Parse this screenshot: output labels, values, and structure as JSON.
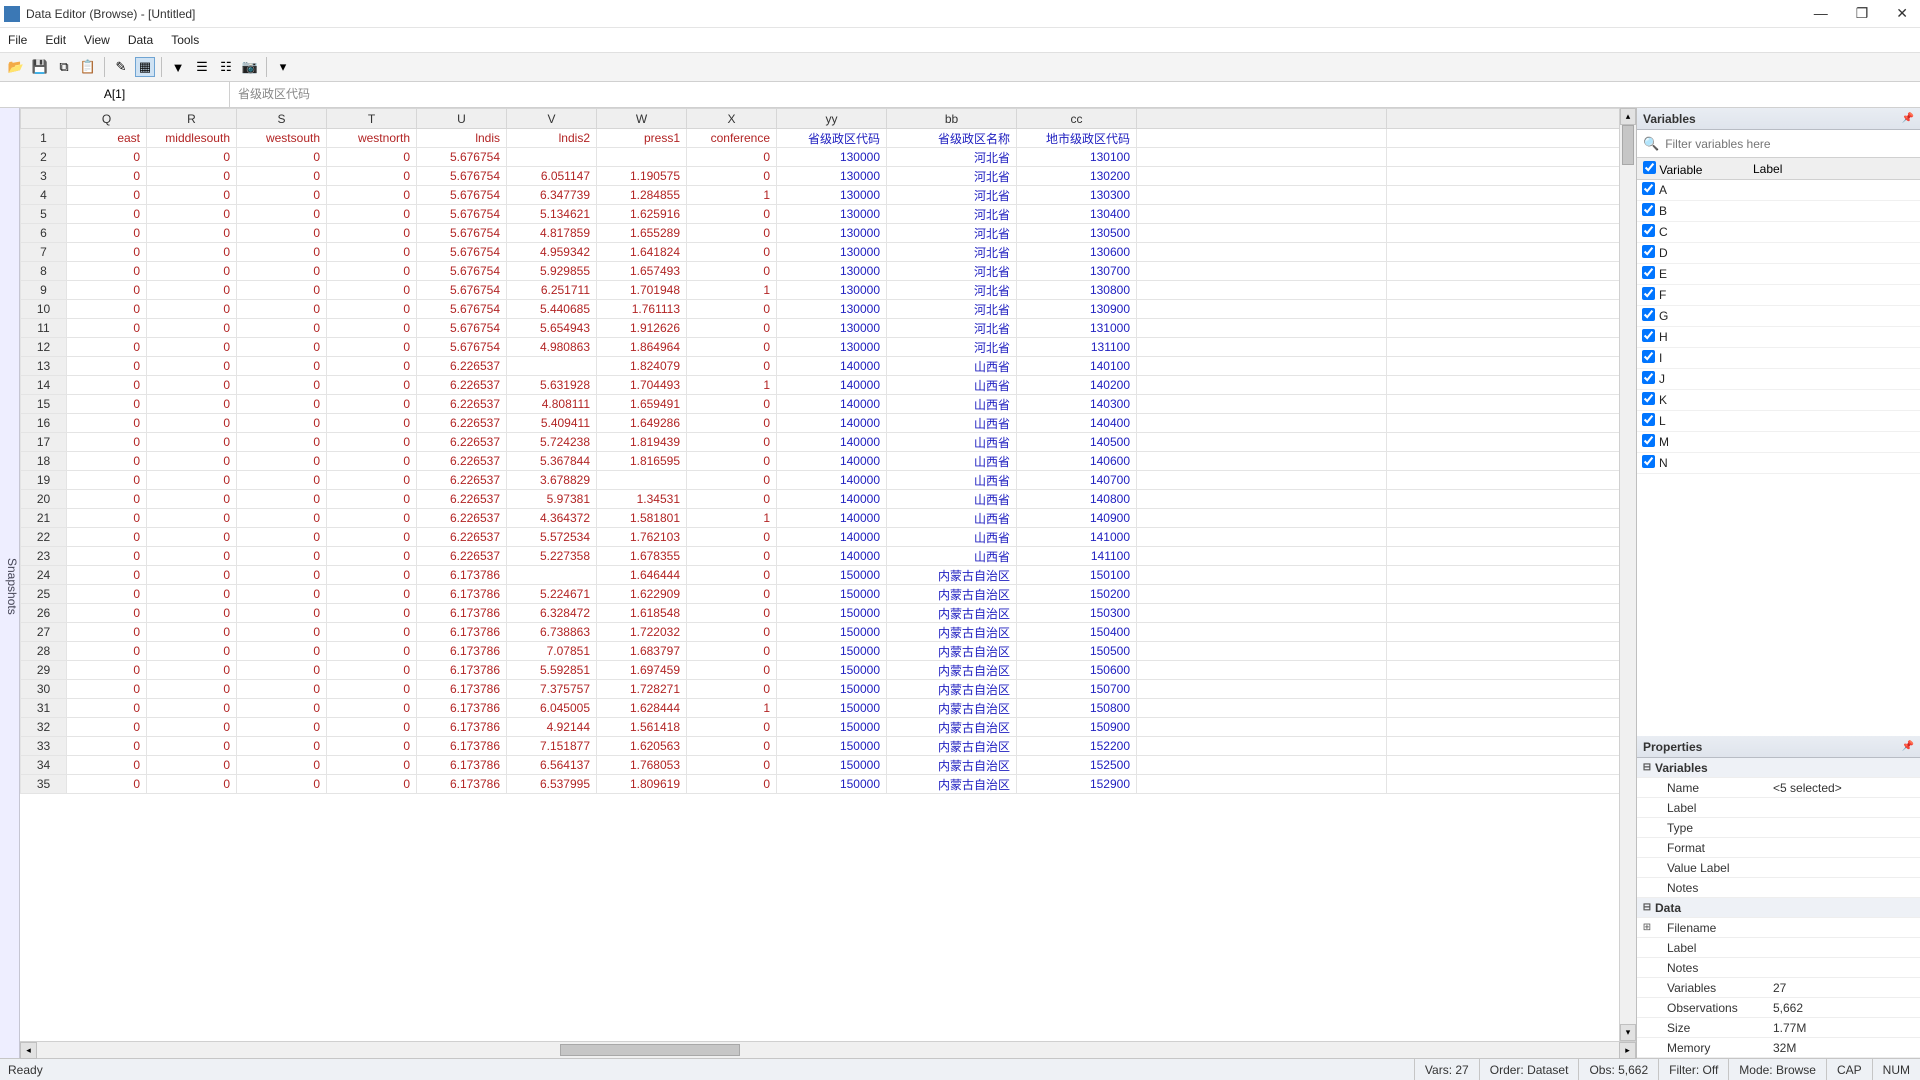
{
  "window": {
    "title": "Data Editor (Browse) - [Untitled]",
    "minimize": "—",
    "maximize": "❐",
    "close": "✕"
  },
  "menus": [
    "File",
    "Edit",
    "View",
    "Data",
    "Tools"
  ],
  "toolbar_icons": [
    "open",
    "save",
    "copy",
    "paste",
    "sep",
    "edit",
    "browse",
    "sep",
    "filter",
    "vars",
    "props",
    "snapshot",
    "sep",
    "dropdown"
  ],
  "address": {
    "cell": "A[1]",
    "value": "省级政区代码"
  },
  "snapshots_tab": "Snapshots",
  "columns": [
    "Q",
    "R",
    "S",
    "T",
    "U",
    "V",
    "W",
    "X",
    "yy",
    "bb",
    "cc"
  ],
  "row1_labels": {
    "Q": "east",
    "R": "middlesouth",
    "S": "westsouth",
    "T": "westnorth",
    "U": "lndis",
    "V": "lndis2",
    "W": "press1",
    "X": "conference",
    "yy": "省级政区代码",
    "bb": "省级政区名称",
    "cc": "地市级政区代码"
  },
  "rows": [
    {
      "n": 2,
      "Q": "0",
      "R": "0",
      "S": "0",
      "T": "0",
      "U": "5.676754",
      "V": "",
      "W": "",
      "X": "0",
      "yy": "130000",
      "bb": "河北省",
      "cc": "130100"
    },
    {
      "n": 3,
      "Q": "0",
      "R": "0",
      "S": "0",
      "T": "0",
      "U": "5.676754",
      "V": "6.051147",
      "W": "1.190575",
      "X": "0",
      "yy": "130000",
      "bb": "河北省",
      "cc": "130200"
    },
    {
      "n": 4,
      "Q": "0",
      "R": "0",
      "S": "0",
      "T": "0",
      "U": "5.676754",
      "V": "6.347739",
      "W": "1.284855",
      "X": "1",
      "yy": "130000",
      "bb": "河北省",
      "cc": "130300"
    },
    {
      "n": 5,
      "Q": "0",
      "R": "0",
      "S": "0",
      "T": "0",
      "U": "5.676754",
      "V": "5.134621",
      "W": "1.625916",
      "X": "0",
      "yy": "130000",
      "bb": "河北省",
      "cc": "130400"
    },
    {
      "n": 6,
      "Q": "0",
      "R": "0",
      "S": "0",
      "T": "0",
      "U": "5.676754",
      "V": "4.817859",
      "W": "1.655289",
      "X": "0",
      "yy": "130000",
      "bb": "河北省",
      "cc": "130500"
    },
    {
      "n": 7,
      "Q": "0",
      "R": "0",
      "S": "0",
      "T": "0",
      "U": "5.676754",
      "V": "4.959342",
      "W": "1.641824",
      "X": "0",
      "yy": "130000",
      "bb": "河北省",
      "cc": "130600"
    },
    {
      "n": 8,
      "Q": "0",
      "R": "0",
      "S": "0",
      "T": "0",
      "U": "5.676754",
      "V": "5.929855",
      "W": "1.657493",
      "X": "0",
      "yy": "130000",
      "bb": "河北省",
      "cc": "130700"
    },
    {
      "n": 9,
      "Q": "0",
      "R": "0",
      "S": "0",
      "T": "0",
      "U": "5.676754",
      "V": "6.251711",
      "W": "1.701948",
      "X": "1",
      "yy": "130000",
      "bb": "河北省",
      "cc": "130800"
    },
    {
      "n": 10,
      "Q": "0",
      "R": "0",
      "S": "0",
      "T": "0",
      "U": "5.676754",
      "V": "5.440685",
      "W": "1.761113",
      "X": "0",
      "yy": "130000",
      "bb": "河北省",
      "cc": "130900"
    },
    {
      "n": 11,
      "Q": "0",
      "R": "0",
      "S": "0",
      "T": "0",
      "U": "5.676754",
      "V": "5.654943",
      "W": "1.912626",
      "X": "0",
      "yy": "130000",
      "bb": "河北省",
      "cc": "131000"
    },
    {
      "n": 12,
      "Q": "0",
      "R": "0",
      "S": "0",
      "T": "0",
      "U": "5.676754",
      "V": "4.980863",
      "W": "1.864964",
      "X": "0",
      "yy": "130000",
      "bb": "河北省",
      "cc": "131100"
    },
    {
      "n": 13,
      "Q": "0",
      "R": "0",
      "S": "0",
      "T": "0",
      "U": "6.226537",
      "V": "",
      "W": "1.824079",
      "X": "0",
      "yy": "140000",
      "bb": "山西省",
      "cc": "140100"
    },
    {
      "n": 14,
      "Q": "0",
      "R": "0",
      "S": "0",
      "T": "0",
      "U": "6.226537",
      "V": "5.631928",
      "W": "1.704493",
      "X": "1",
      "yy": "140000",
      "bb": "山西省",
      "cc": "140200"
    },
    {
      "n": 15,
      "Q": "0",
      "R": "0",
      "S": "0",
      "T": "0",
      "U": "6.226537",
      "V": "4.808111",
      "W": "1.659491",
      "X": "0",
      "yy": "140000",
      "bb": "山西省",
      "cc": "140300"
    },
    {
      "n": 16,
      "Q": "0",
      "R": "0",
      "S": "0",
      "T": "0",
      "U": "6.226537",
      "V": "5.409411",
      "W": "1.649286",
      "X": "0",
      "yy": "140000",
      "bb": "山西省",
      "cc": "140400"
    },
    {
      "n": 17,
      "Q": "0",
      "R": "0",
      "S": "0",
      "T": "0",
      "U": "6.226537",
      "V": "5.724238",
      "W": "1.819439",
      "X": "0",
      "yy": "140000",
      "bb": "山西省",
      "cc": "140500"
    },
    {
      "n": 18,
      "Q": "0",
      "R": "0",
      "S": "0",
      "T": "0",
      "U": "6.226537",
      "V": "5.367844",
      "W": "1.816595",
      "X": "0",
      "yy": "140000",
      "bb": "山西省",
      "cc": "140600"
    },
    {
      "n": 19,
      "Q": "0",
      "R": "0",
      "S": "0",
      "T": "0",
      "U": "6.226537",
      "V": "3.678829",
      "W": "",
      "X": "0",
      "yy": "140000",
      "bb": "山西省",
      "cc": "140700"
    },
    {
      "n": 20,
      "Q": "0",
      "R": "0",
      "S": "0",
      "T": "0",
      "U": "6.226537",
      "V": "5.97381",
      "W": "1.34531",
      "X": "0",
      "yy": "140000",
      "bb": "山西省",
      "cc": "140800"
    },
    {
      "n": 21,
      "Q": "0",
      "R": "0",
      "S": "0",
      "T": "0",
      "U": "6.226537",
      "V": "4.364372",
      "W": "1.581801",
      "X": "1",
      "yy": "140000",
      "bb": "山西省",
      "cc": "140900"
    },
    {
      "n": 22,
      "Q": "0",
      "R": "0",
      "S": "0",
      "T": "0",
      "U": "6.226537",
      "V": "5.572534",
      "W": "1.762103",
      "X": "0",
      "yy": "140000",
      "bb": "山西省",
      "cc": "141000"
    },
    {
      "n": 23,
      "Q": "0",
      "R": "0",
      "S": "0",
      "T": "0",
      "U": "6.226537",
      "V": "5.227358",
      "W": "1.678355",
      "X": "0",
      "yy": "140000",
      "bb": "山西省",
      "cc": "141100"
    },
    {
      "n": 24,
      "Q": "0",
      "R": "0",
      "S": "0",
      "T": "0",
      "U": "6.173786",
      "V": "",
      "W": "1.646444",
      "X": "0",
      "yy": "150000",
      "bb": "内蒙古自治区",
      "cc": "150100"
    },
    {
      "n": 25,
      "Q": "0",
      "R": "0",
      "S": "0",
      "T": "0",
      "U": "6.173786",
      "V": "5.224671",
      "W": "1.622909",
      "X": "0",
      "yy": "150000",
      "bb": "内蒙古自治区",
      "cc": "150200"
    },
    {
      "n": 26,
      "Q": "0",
      "R": "0",
      "S": "0",
      "T": "0",
      "U": "6.173786",
      "V": "6.328472",
      "W": "1.618548",
      "X": "0",
      "yy": "150000",
      "bb": "内蒙古自治区",
      "cc": "150300"
    },
    {
      "n": 27,
      "Q": "0",
      "R": "0",
      "S": "0",
      "T": "0",
      "U": "6.173786",
      "V": "6.738863",
      "W": "1.722032",
      "X": "0",
      "yy": "150000",
      "bb": "内蒙古自治区",
      "cc": "150400"
    },
    {
      "n": 28,
      "Q": "0",
      "R": "0",
      "S": "0",
      "T": "0",
      "U": "6.173786",
      "V": "7.07851",
      "W": "1.683797",
      "X": "0",
      "yy": "150000",
      "bb": "内蒙古自治区",
      "cc": "150500"
    },
    {
      "n": 29,
      "Q": "0",
      "R": "0",
      "S": "0",
      "T": "0",
      "U": "6.173786",
      "V": "5.592851",
      "W": "1.697459",
      "X": "0",
      "yy": "150000",
      "bb": "内蒙古自治区",
      "cc": "150600"
    },
    {
      "n": 30,
      "Q": "0",
      "R": "0",
      "S": "0",
      "T": "0",
      "U": "6.173786",
      "V": "7.375757",
      "W": "1.728271",
      "X": "0",
      "yy": "150000",
      "bb": "内蒙古自治区",
      "cc": "150700"
    },
    {
      "n": 31,
      "Q": "0",
      "R": "0",
      "S": "0",
      "T": "0",
      "U": "6.173786",
      "V": "6.045005",
      "W": "1.628444",
      "X": "1",
      "yy": "150000",
      "bb": "内蒙古自治区",
      "cc": "150800"
    },
    {
      "n": 32,
      "Q": "0",
      "R": "0",
      "S": "0",
      "T": "0",
      "U": "6.173786",
      "V": "4.92144",
      "W": "1.561418",
      "X": "0",
      "yy": "150000",
      "bb": "内蒙古自治区",
      "cc": "150900"
    },
    {
      "n": 33,
      "Q": "0",
      "R": "0",
      "S": "0",
      "T": "0",
      "U": "6.173786",
      "V": "7.151877",
      "W": "1.620563",
      "X": "0",
      "yy": "150000",
      "bb": "内蒙古自治区",
      "cc": "152200"
    },
    {
      "n": 34,
      "Q": "0",
      "R": "0",
      "S": "0",
      "T": "0",
      "U": "6.173786",
      "V": "6.564137",
      "W": "1.768053",
      "X": "0",
      "yy": "150000",
      "bb": "内蒙古自治区",
      "cc": "152500"
    },
    {
      "n": 35,
      "Q": "0",
      "R": "0",
      "S": "0",
      "T": "0",
      "U": "6.173786",
      "V": "6.537995",
      "W": "1.809619",
      "X": "0",
      "yy": "150000",
      "bb": "内蒙古自治区",
      "cc": "152900"
    }
  ],
  "variables_panel": {
    "title": "Variables",
    "filter_placeholder": "Filter variables here",
    "header": {
      "c0": "Variable",
      "c1": "Label"
    },
    "items": [
      "A",
      "B",
      "C",
      "D",
      "E",
      "F",
      "G",
      "H",
      "I",
      "J",
      "K",
      "L",
      "M",
      "N"
    ]
  },
  "properties_panel": {
    "title": "Properties",
    "sections": {
      "variables": {
        "label": "Variables",
        "rows": [
          [
            "Name",
            "<5 selected>"
          ],
          [
            "Label",
            ""
          ],
          [
            "Type",
            ""
          ],
          [
            "Format",
            ""
          ],
          [
            "Value Label",
            ""
          ],
          [
            "Notes",
            ""
          ]
        ]
      },
      "data": {
        "label": "Data",
        "rows": [
          [
            "Filename",
            ""
          ],
          [
            "Label",
            ""
          ],
          [
            "Notes",
            ""
          ],
          [
            "Variables",
            "27"
          ],
          [
            "Observations",
            "5,662"
          ],
          [
            "Size",
            "1.77M"
          ],
          [
            "Memory",
            "32M"
          ]
        ]
      }
    }
  },
  "statusbar": {
    "ready": "Ready",
    "vars": "Vars: 27",
    "order": "Order: Dataset",
    "obs": "Obs: 5,662",
    "filter": "Filter: Off",
    "mode": "Mode: Browse",
    "cap": "CAP",
    "num": "NUM"
  }
}
